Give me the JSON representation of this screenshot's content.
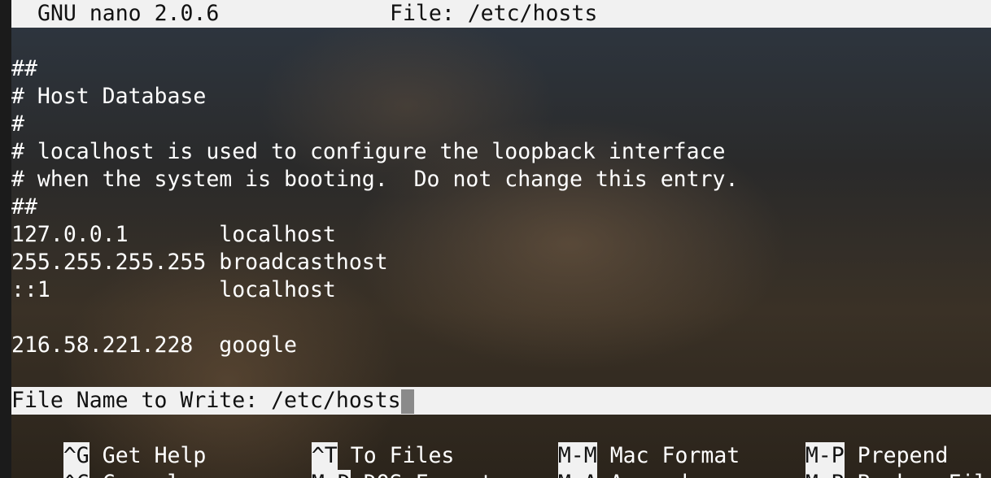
{
  "header": {
    "app_name": "GNU nano 2.0.6",
    "file_label": "File: /etc/hosts"
  },
  "content": {
    "lines": [
      "",
      "##",
      "# Host Database",
      "#",
      "# localhost is used to configure the loopback interface",
      "# when the system is booting.  Do not change this entry.",
      "##",
      "127.0.0.1       localhost",
      "255.255.255.255 broadcasthost",
      "::1             localhost",
      "",
      "216.58.221.228  google"
    ]
  },
  "prompt": {
    "label": "File Name to Write: ",
    "value": "/etc/hosts"
  },
  "shortcuts": {
    "row1": [
      {
        "key": "^G",
        "label": "Get Help"
      },
      {
        "key": "^T",
        "label": "To Files"
      },
      {
        "key": "M-M",
        "label": "Mac Format"
      },
      {
        "key": "M-P",
        "label": "Prepend"
      }
    ],
    "row2": [
      {
        "key": "^C",
        "label": "Cancel"
      },
      {
        "key": "M-D",
        "label": "DOS Format"
      },
      {
        "key": "M-A",
        "label": "Append"
      },
      {
        "key": "M-B",
        "label": "Backup File"
      }
    ]
  }
}
